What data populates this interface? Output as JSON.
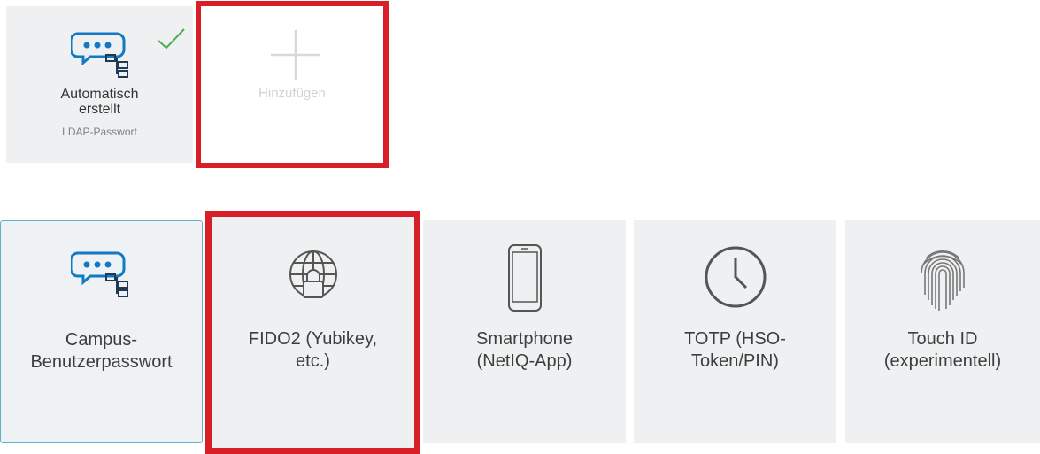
{
  "enrolled": {
    "title": "Automatisch\nerstellt",
    "subtitle": "LDAP-Passwort",
    "icons": {
      "main": "password-chat-network-icon",
      "status": "checkmark-icon"
    },
    "check_color": "#4caf50"
  },
  "add": {
    "label": "Hinzufügen",
    "icon": "plus-icon"
  },
  "methods": [
    {
      "label": "Campus-\nBenutzerpasswort",
      "icon": "password-chat-network-icon"
    },
    {
      "label": "FIDO2 (Yubikey,\netc.)",
      "icon": "globe-lock-icon"
    },
    {
      "label": "Smartphone\n(NetIQ-App)",
      "icon": "smartphone-icon"
    },
    {
      "label": "TOTP (HSO-\nToken/PIN)",
      "icon": "clock-icon"
    },
    {
      "label": "Touch ID\n(experimentell)",
      "icon": "fingerprint-icon"
    }
  ],
  "colors": {
    "highlight": "#d81e26",
    "selected_border": "#5fb4cc",
    "icon_blue": "#1279c4",
    "card_bg": "#eef0f1"
  }
}
